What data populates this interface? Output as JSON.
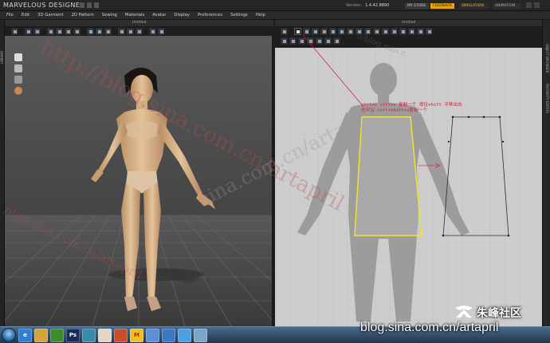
{
  "app": {
    "title": "MARVELOUS DESIGNER 4",
    "version_label": "Version:",
    "version_value": "1.4.42.8890",
    "account_label": "MY STORE",
    "feedback_label": "FEEDBACK",
    "simulation_label": "SIMULATION",
    "animation_label": "ANIMATION"
  },
  "menu": [
    "File",
    "Edit",
    "3D Garment",
    "2D Pattern",
    "Sewing",
    "Materials",
    "Avatar",
    "Display",
    "Preferences",
    "Settings",
    "Help"
  ],
  "sidebars": {
    "left_label": "LIBRARY",
    "right_labels": [
      "OBJECT BROWSER",
      "PROPERTY EDITOR"
    ]
  },
  "panels": {
    "view3d_title": "Untitled",
    "view2d_title": "Untitled"
  },
  "annotation": {
    "line1": "ctrl+c ctrl+v 复制一个 按住shift 平移出去",
    "line2": "也可以 ctrl+shift+v复制一个"
  },
  "watermarks": {
    "main": "http://blog.sina.com.cn/artapril",
    "small": "blog.sina.com.cn/artapril",
    "partial": "://blog.sina.c",
    "diag": "sina.com.cn/artapr"
  },
  "branding": {
    "site_name": "朱峰社区",
    "blog_url": "blog.sina.com.cn/artapril"
  },
  "taskbar_icons": [
    "start-orb",
    "ie-icon",
    "folder-icon",
    "nvidia-icon",
    "photoshop-icon",
    "maya-icon",
    "chrome-icon",
    "paint-icon",
    "gmail-icon",
    "qq-icon",
    "browser-icon",
    "mail-icon",
    "tool-icon"
  ],
  "colors": {
    "feedback": "#e7a20c",
    "simulation": "#e6b51d",
    "selected_pattern": "#f1e628",
    "annotation": "#e0103a"
  }
}
